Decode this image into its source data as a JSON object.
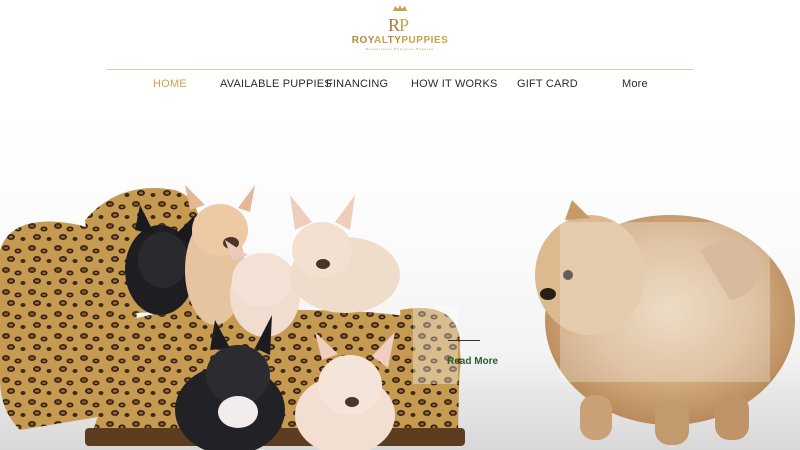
{
  "brand": {
    "name_part1": "ROY",
    "name_part2": "AL",
    "name_part3": "TY",
    "name_part4": "PUPPIES",
    "tagline": "Exceptional Pedigree Puppies",
    "monogram": "RP",
    "color_gold": "#c9a24a",
    "color_brown": "#b48a3c"
  },
  "nav": {
    "items": [
      {
        "label": "HOME",
        "active": true
      },
      {
        "label": "AVAILABLE PUPPIES",
        "active": false
      },
      {
        "label": "FINANCING",
        "active": false
      },
      {
        "label": "HOW IT WORKS",
        "active": false
      },
      {
        "label": "GIFT CARD",
        "active": false
      },
      {
        "label": "More",
        "active": false
      }
    ],
    "active_color": "#c9a24a"
  },
  "hero": {
    "read_more": "Read More",
    "image_subjects": [
      "leopard-print-armchair",
      "french-bulldog-puppies",
      "pomeranian"
    ]
  }
}
